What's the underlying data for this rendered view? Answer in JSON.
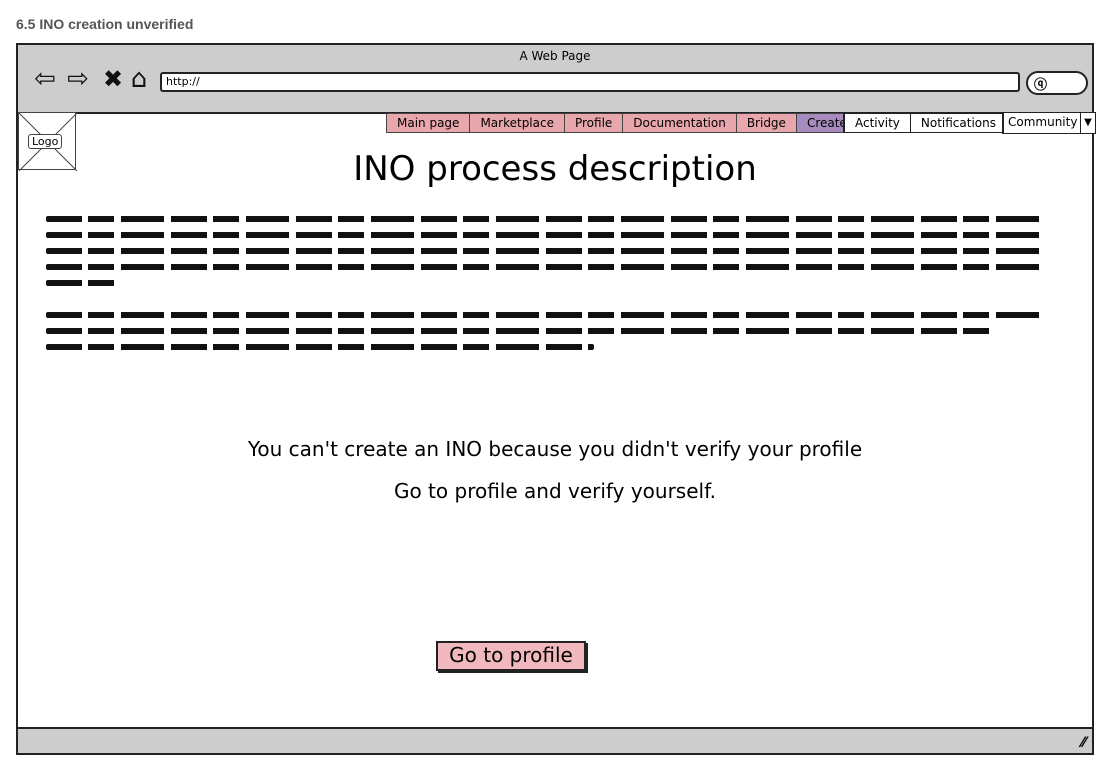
{
  "page_label": "6.5 INO creation unverified",
  "window": {
    "title": "A Web Page",
    "address": "http://",
    "icons": {
      "back": "back-arrow-icon",
      "forward": "forward-arrow-icon",
      "stop": "close-icon",
      "home": "home-icon",
      "search": "search-icon",
      "resize": "resize-grip-icon"
    }
  },
  "logo": {
    "label": "Logo"
  },
  "nav": {
    "items": [
      "Main page",
      "Marketplace",
      "Profile",
      "Documentation",
      "Bridge",
      "Create"
    ],
    "active": "Create"
  },
  "user_nav": {
    "items": [
      "Activity",
      "Notifications"
    ],
    "dropdown": "Community"
  },
  "main": {
    "title": "INO process description",
    "message_line1": "You can't create an INO because you didn't verify your profile",
    "message_line2": "Go to profile and verify yourself.",
    "button_label": "Go to profile"
  },
  "colors": {
    "nav_bg": "#e8a7ad",
    "nav_active": "#a78bbf",
    "button_bg": "#f1b8bd",
    "chrome": "#cdcdcd"
  }
}
